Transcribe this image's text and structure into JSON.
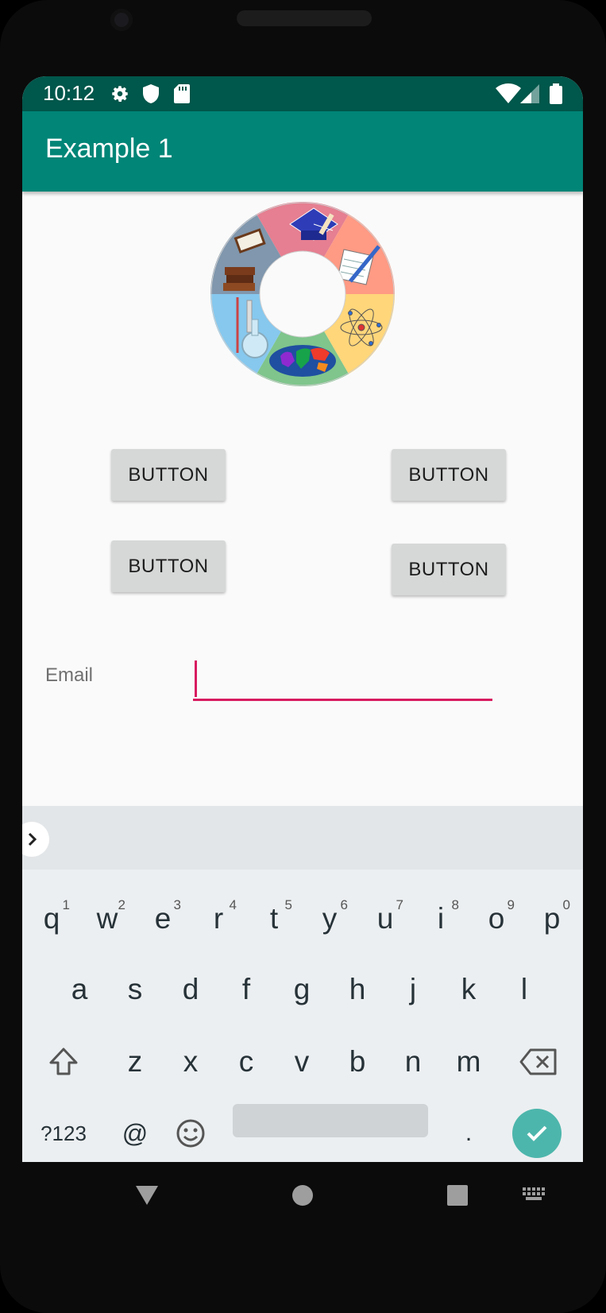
{
  "status_bar": {
    "time": "10:12",
    "left_icons": [
      "gear-icon",
      "shield-icon",
      "sd-card-icon"
    ],
    "right_icons": [
      "wifi-icon",
      "signal-icon",
      "battery-icon"
    ]
  },
  "app_bar": {
    "title": "Example 1"
  },
  "wheel": {
    "segments": [
      "graduation-cap",
      "writing",
      "atom",
      "world-map",
      "lab-flask",
      "books"
    ],
    "colors": [
      "#e57f91",
      "#ff9a84",
      "#ffd67a",
      "#7fc58c",
      "#86c8ee",
      "#8097ad"
    ]
  },
  "buttons": [
    {
      "label": "BUTTON"
    },
    {
      "label": "BUTTON"
    },
    {
      "label": "BUTTON"
    },
    {
      "label": "BUTTON"
    }
  ],
  "form": {
    "email_label": "Email",
    "email_value": ""
  },
  "keyboard": {
    "row1": [
      {
        "key": "q",
        "hint": "1"
      },
      {
        "key": "w",
        "hint": "2"
      },
      {
        "key": "e",
        "hint": "3"
      },
      {
        "key": "r",
        "hint": "4"
      },
      {
        "key": "t",
        "hint": "5"
      },
      {
        "key": "y",
        "hint": "6"
      },
      {
        "key": "u",
        "hint": "7"
      },
      {
        "key": "i",
        "hint": "8"
      },
      {
        "key": "o",
        "hint": "9"
      },
      {
        "key": "p",
        "hint": "0"
      }
    ],
    "row2": [
      "a",
      "s",
      "d",
      "f",
      "g",
      "h",
      "j",
      "k",
      "l"
    ],
    "row3": [
      "z",
      "x",
      "c",
      "v",
      "b",
      "n",
      "m"
    ],
    "symbols_label": "?123",
    "at_label": "@",
    "period_label": ".",
    "accent_color": "#4db6ac"
  },
  "colors": {
    "status_bar": "#00574b",
    "app_bar": "#008577",
    "input_accent": "#d81b60"
  }
}
